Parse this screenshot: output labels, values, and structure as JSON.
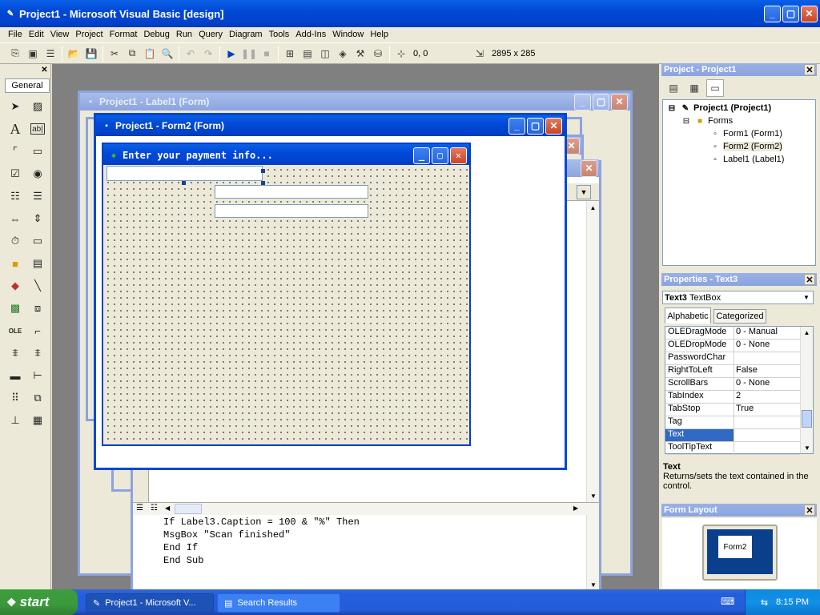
{
  "app": {
    "title": "Project1 - Microsoft Visual Basic [design]"
  },
  "menu": [
    "File",
    "Edit",
    "View",
    "Project",
    "Format",
    "Debug",
    "Run",
    "Query",
    "Diagram",
    "Tools",
    "Add-Ins",
    "Window",
    "Help"
  ],
  "toolbar": {
    "position": "0, 0",
    "size": "2895 x 285"
  },
  "toolbox": {
    "tab": "General"
  },
  "windows": {
    "label_form": "Project1 - Label1 (Form)",
    "form2": "Project1 - Form2 (Form)",
    "form_caption": "Enter your payment info..."
  },
  "code": {
    "lines": [
      "If Label3.Caption = 100 & \"%\" Then",
      "MsgBox \"Scan finished\"",
      "End If",
      "End Sub"
    ]
  },
  "project": {
    "title": "Project - Project1",
    "root": "Project1 (Project1)",
    "folder": "Forms",
    "items": [
      "Form1 (Form1)",
      "Form2 (Form2)",
      "Label1 (Label1)"
    ]
  },
  "properties": {
    "title": "Properties - Text3",
    "object_name": "Text3",
    "object_type": "TextBox",
    "tabs": [
      "Alphabetic",
      "Categorized"
    ],
    "rows": [
      {
        "name": "OLEDragMode",
        "value": "0 - Manual"
      },
      {
        "name": "OLEDropMode",
        "value": "0 - None"
      },
      {
        "name": "PasswordChar",
        "value": ""
      },
      {
        "name": "RightToLeft",
        "value": "False"
      },
      {
        "name": "ScrollBars",
        "value": "0 - None"
      },
      {
        "name": "TabIndex",
        "value": "2"
      },
      {
        "name": "TabStop",
        "value": "True"
      },
      {
        "name": "Tag",
        "value": ""
      },
      {
        "name": "Text",
        "value": ""
      },
      {
        "name": "ToolTipText",
        "value": ""
      }
    ],
    "selected": "Text",
    "desc_title": "Text",
    "desc_text": "Returns/sets the text contained in the control."
  },
  "form_layout": {
    "title": "Form Layout",
    "thumb_label": "Form2"
  },
  "taskbar": {
    "start": "start",
    "tasks": [
      "Project1 - Microsoft V...",
      "Search Results"
    ],
    "clock": "8:15 PM"
  }
}
